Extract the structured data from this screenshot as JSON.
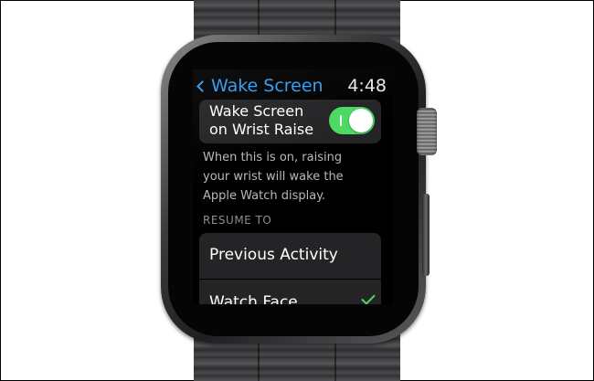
{
  "device": {
    "accent_color": "#2e9bf0",
    "toggle_on_color": "#4cd964"
  },
  "header": {
    "back_label": "Wake Screen",
    "time": "4:48"
  },
  "wake_toggle": {
    "label_line1": "Wake Screen",
    "label_line2": "on Wrist Raise",
    "state": "on",
    "description_line1": "When this is on, raising",
    "description_line2": "your wrist will wake the",
    "description_line3": "Apple Watch display."
  },
  "resume_section": {
    "header": "RESUME TO",
    "options": [
      {
        "label": "Previous Activity",
        "selected": false
      },
      {
        "label": "Watch Face",
        "selected": true
      }
    ]
  }
}
